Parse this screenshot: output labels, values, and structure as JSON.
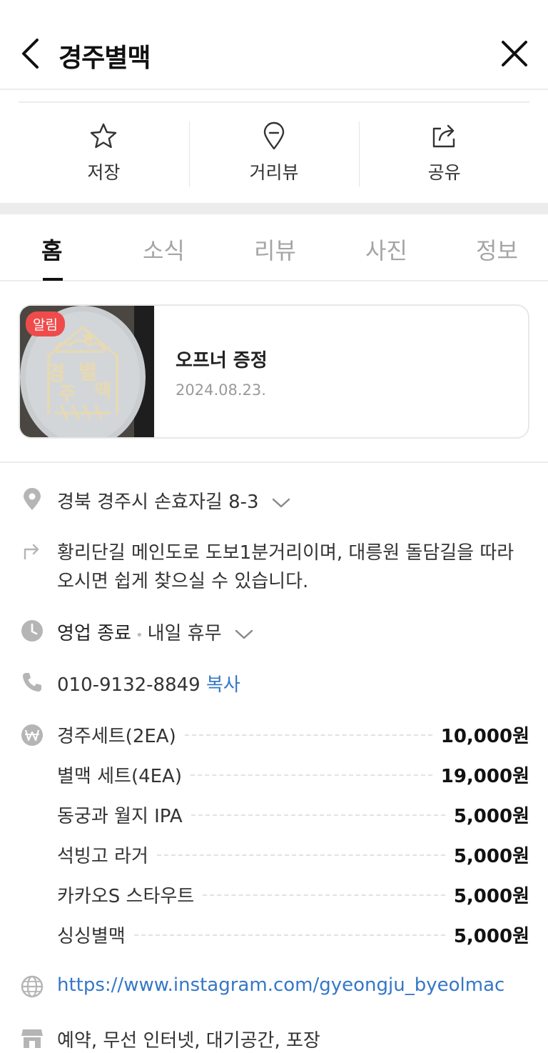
{
  "header": {
    "title": "경주별맥"
  },
  "actions": [
    {
      "label": "저장",
      "icon": "star-icon"
    },
    {
      "label": "거리뷰",
      "icon": "map-pin-icon"
    },
    {
      "label": "공유",
      "icon": "share-icon"
    }
  ],
  "tabs": [
    "홈",
    "소식",
    "리뷰",
    "사진",
    "정보"
  ],
  "active_tab": "홈",
  "notice": {
    "badge": "알림",
    "title": "오프너 증정",
    "date": "2024.08.23.",
    "thumbnail_text": "경주별맥"
  },
  "info": {
    "address": "경북 경주시 손효자길 8-3",
    "directions": "황리단길 메인도로 도보1분거리이며, 대릉원 돌담길을 따라 오시면 쉽게 찾으실 수 있습니다.",
    "hours_status": "영업 종료",
    "hours_next": "내일 휴무",
    "phone": "010-9132-8849",
    "copy_label": "복사",
    "website": "https://www.instagram.com/gyeongju_byeolmac",
    "facilities": "예약, 무선 인터넷, 대기공간, 포장"
  },
  "menu": [
    {
      "name": "경주세트(2EA)",
      "price": "10,000원"
    },
    {
      "name": "별맥 세트(4EA)",
      "price": "19,000원"
    },
    {
      "name": "동궁과 월지 IPA",
      "price": "5,000원"
    },
    {
      "name": "석빙고 라거",
      "price": "5,000원"
    },
    {
      "name": "카카오S 스타우트",
      "price": "5,000원"
    },
    {
      "name": "싱싱별맥",
      "price": "5,000원"
    }
  ],
  "colors": {
    "link": "#3577c7",
    "badge": "#ef4b4b",
    "icon_gray": "#b5b5b5"
  }
}
